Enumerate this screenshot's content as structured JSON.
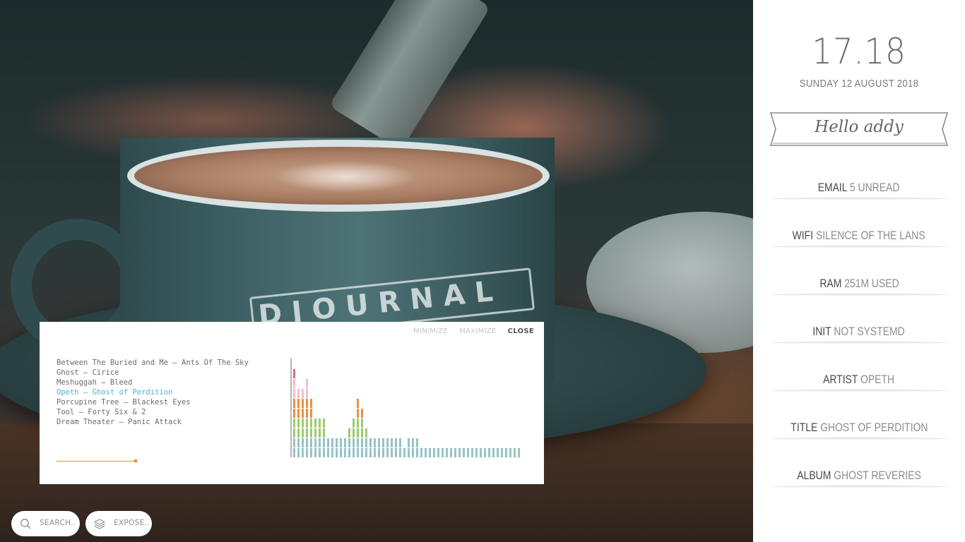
{
  "sidebar": {
    "time": "17.18",
    "date": "SUNDAY 12 AUGUST 2018",
    "greeting": "Hello addy",
    "items": [
      {
        "key": "EMAIL",
        "value": "5 UNREAD"
      },
      {
        "key": "WIFI",
        "value": "SILENCE OF THE LANS"
      },
      {
        "key": "RAM",
        "value": "251M USED"
      },
      {
        "key": "INIT",
        "value": "NOT SYSTEMD"
      },
      {
        "key": "ARTIST",
        "value": "OPETH"
      },
      {
        "key": "TITLE",
        "value": "GHOST OF PERDITION"
      },
      {
        "key": "ALBUM",
        "value": "GHOST REVERIES"
      }
    ]
  },
  "player": {
    "controls": {
      "minimize": "MINIMIZE",
      "maximize": "MAXIMIZE",
      "close": "CLOSE"
    },
    "playlist": [
      "Between The Buried and Me – Ants Of The Sky",
      "Ghost – Cirice",
      "Meshuggah – Bleed",
      "Opeth – Ghost of Perdition",
      "Porcupine Tree – Blackest Eyes",
      "Tool – Forty Six & 2",
      "Dream Theater – Panic Attack"
    ],
    "active_index": 3,
    "progress": 0.33,
    "colors": {
      "active": "#48b6d0",
      "progress": "#e38b3a"
    },
    "visualizer": {
      "levels": [
        9,
        7,
        7,
        8,
        6,
        4,
        4,
        4,
        2,
        2,
        2,
        2,
        2,
        3,
        4,
        6,
        5,
        3,
        2,
        2,
        2,
        2,
        2,
        2,
        2,
        2,
        1,
        2,
        2,
        2,
        1,
        1,
        1,
        1,
        1,
        1,
        1,
        1,
        1,
        1,
        1,
        1,
        1,
        1,
        1,
        1,
        1,
        1,
        1,
        1,
        1,
        1,
        1,
        1
      ],
      "max_level": 9,
      "band_colors": [
        "#96c3c7",
        "#9ccc6e",
        "#e8913f",
        "#f2c0c9",
        "#d86a7d"
      ]
    }
  },
  "taskbar": {
    "search_label": "SEARCH..",
    "expose_label": "EXPOSE..",
    "icons": {
      "search": "search-icon",
      "expose": "layers-icon"
    }
  }
}
